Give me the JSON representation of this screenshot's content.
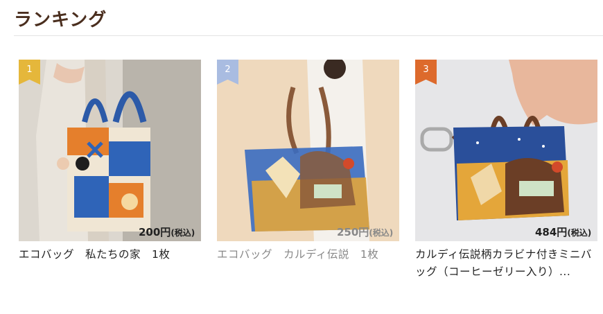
{
  "page": {
    "title": "ランキング"
  },
  "ranking": {
    "items": [
      {
        "rank": "1",
        "name": "エコバッグ　私たちの家　1枚",
        "price": "200円",
        "tax_label": "(税込)",
        "rank_color": "#e5b73b"
      },
      {
        "rank": "2",
        "name": "エコバッグ　カルディ伝説　1枚",
        "price": "250円",
        "tax_label": "(税込)",
        "rank_color": "#a9bce1"
      },
      {
        "rank": "3",
        "name": "カルディ伝説柄カラビナ付きミニバッグ（コーヒーゼリー入り）...",
        "price": "484円",
        "tax_label": "(税込)",
        "rank_color": "#dd6a2c"
      }
    ]
  }
}
